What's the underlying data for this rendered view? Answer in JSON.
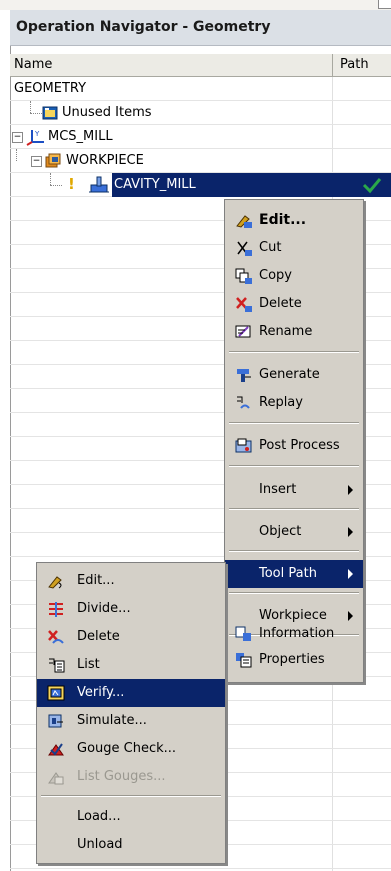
{
  "window": {
    "title": "Operation Navigator - Geometry"
  },
  "columns": {
    "name": "Name",
    "path": "Path"
  },
  "tree": {
    "root": "GEOMETRY",
    "unused": "Unused Items",
    "mcs": "MCS_MILL",
    "workpiece": "WORKPIECE",
    "operation": "CAVITY_MILL",
    "operation_status": "!"
  },
  "context_menu": {
    "edit": "Edit...",
    "cut": "Cut",
    "copy": "Copy",
    "delete": "Delete",
    "rename": "Rename",
    "generate": "Generate",
    "replay": "Replay",
    "post_process": "Post Process",
    "insert": "Insert",
    "object": "Object",
    "tool_path": "Tool Path",
    "workpiece": "Workpiece",
    "information": "Information",
    "properties": "Properties"
  },
  "toolpath_menu": {
    "edit": "Edit...",
    "divide": "Divide...",
    "delete": "Delete",
    "list": "List",
    "verify": "Verify...",
    "simulate": "Simulate...",
    "gouge_check": "Gouge Check...",
    "list_gouges": "List Gouges...",
    "load": "Load...",
    "unload": "Unload"
  },
  "colors": {
    "highlight": "#0a246a",
    "menu_bg": "#d4d0c8",
    "check": "#2aa84a"
  }
}
